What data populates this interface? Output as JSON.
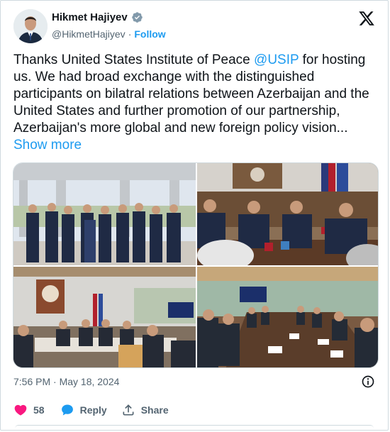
{
  "author": {
    "name": "Hikmet Hajiyev",
    "handle": "@HikmetHajiyev",
    "separator": "·",
    "follow_label": "Follow"
  },
  "tweet": {
    "text_part1": "Thanks United States Institute of Peace ",
    "mention": "@USIP",
    "text_part2": " for hosting us. We had broad exchange with the distinguished participants on bilatral relations between Azerbaijan and the United States and further promotion of our partnership, Azerbaijan's more global and new foreign policy vision...",
    "show_more": "Show more"
  },
  "meta": {
    "timestamp": "7:56 PM · May 18, 2024"
  },
  "actions": {
    "like_count": "58",
    "reply_label": "Reply",
    "share_label": "Share"
  },
  "colors": {
    "accent": "#1d9bf0",
    "like": "#f91880",
    "muted": "#536471"
  }
}
